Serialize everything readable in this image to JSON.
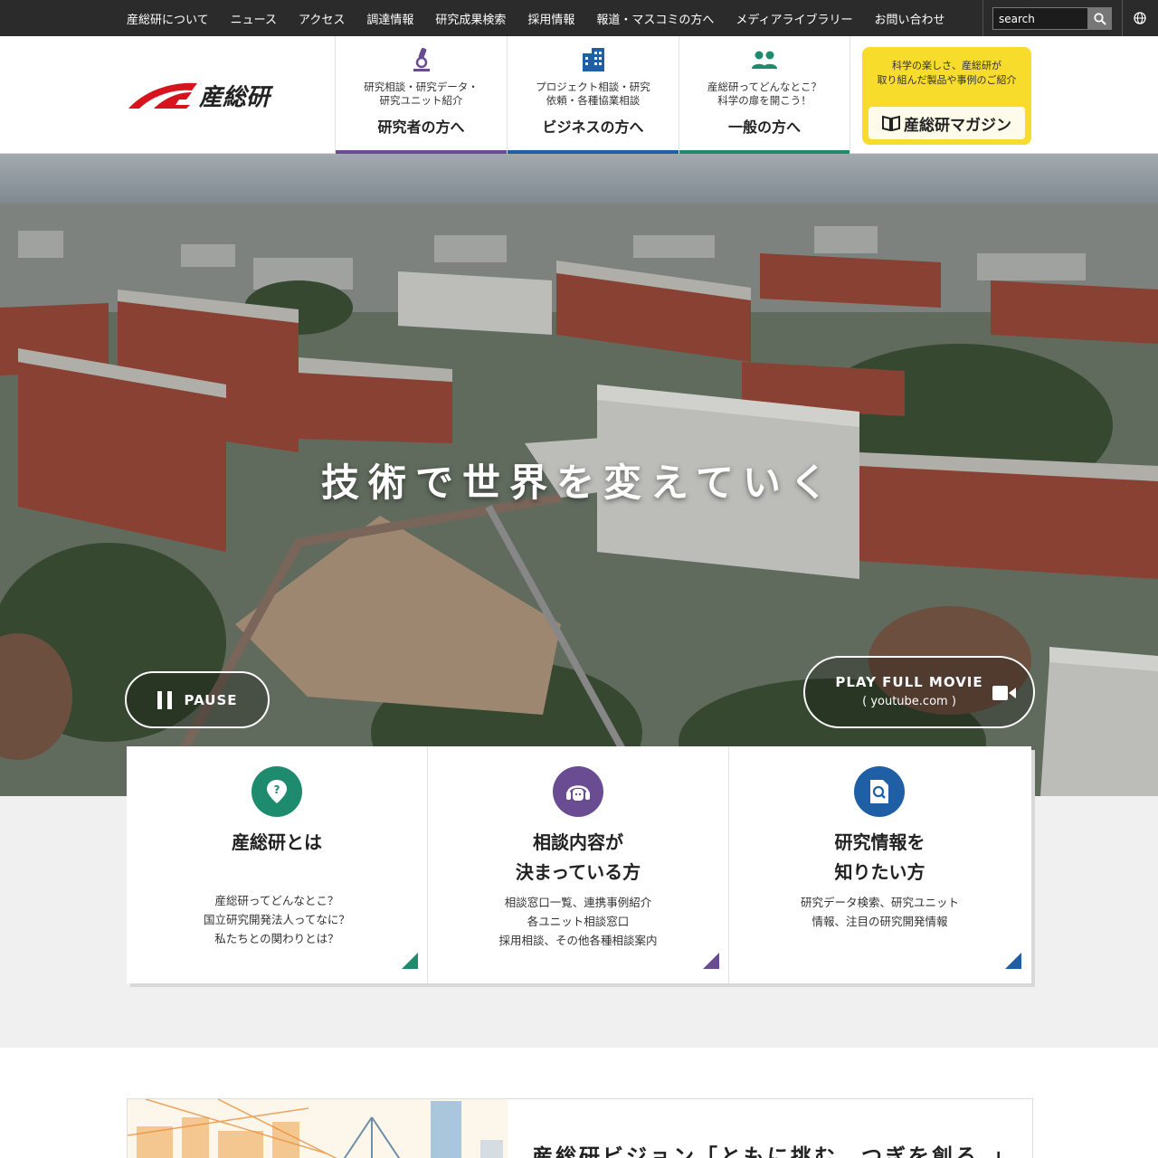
{
  "topnav": {
    "links": [
      "産総研について",
      "ニュース",
      "アクセス",
      "調達情報",
      "研究成果検索",
      "採用情報",
      "報道・マスコミの方へ",
      "メディアライブラリー",
      "お問い合わせ"
    ],
    "search_placeholder": "search"
  },
  "header": {
    "logo_text": "産総研",
    "nav": [
      {
        "sub": "研究相談・研究データ・研究ユニット紹介",
        "main": "研究者の方へ",
        "color": "#6a4c93"
      },
      {
        "sub": "プロジェクト相談・研究依頼・各種協業相談",
        "main": "ビジネスの方へ",
        "color": "#1f5fa6"
      },
      {
        "sub": "産総研ってどんなとこ？科学の扉を開こう！",
        "main": "一般の方へ",
        "color": "#1e8a6e"
      }
    ],
    "magazine": {
      "line1": "科学の楽しさ、産総研が",
      "line2": "取り組んだ製品や事例のご紹介",
      "label": "産総研マガジン"
    }
  },
  "hero": {
    "title": "技術で世界を変えていく",
    "pause_label": "PAUSE",
    "movie_label": "PLAY FULL MOVIE",
    "movie_sub": "( youtube.com )"
  },
  "cards": [
    {
      "title1": "産総研とは",
      "title2": "",
      "desc": [
        "産総研ってどんなとこ？",
        "国立研究開発法人ってなに？",
        "私たちとの関わりとは？"
      ],
      "color": "#1e8a6e"
    },
    {
      "title1": "相談内容が",
      "title2": "決まっている方",
      "desc": [
        "相談窓口一覧、連携事例紹介",
        "各ユニット相談窓口",
        "採用相談、その他各種相談案内"
      ],
      "color": "#6a4c93"
    },
    {
      "title1": "研究情報を",
      "title2": "知りたい方",
      "desc": [
        "研究データ検索、研究ユニット",
        "情報、注目の研究開発情報"
      ],
      "color": "#1f5fa6"
    }
  ],
  "vision": {
    "title": "産総研ビジョン「ともに挑む。つぎを創る。」"
  },
  "colors": {
    "topbar": "#2b2b2b",
    "brand_red": "#d7141e",
    "magazine_yellow": "#f7dc2b"
  }
}
